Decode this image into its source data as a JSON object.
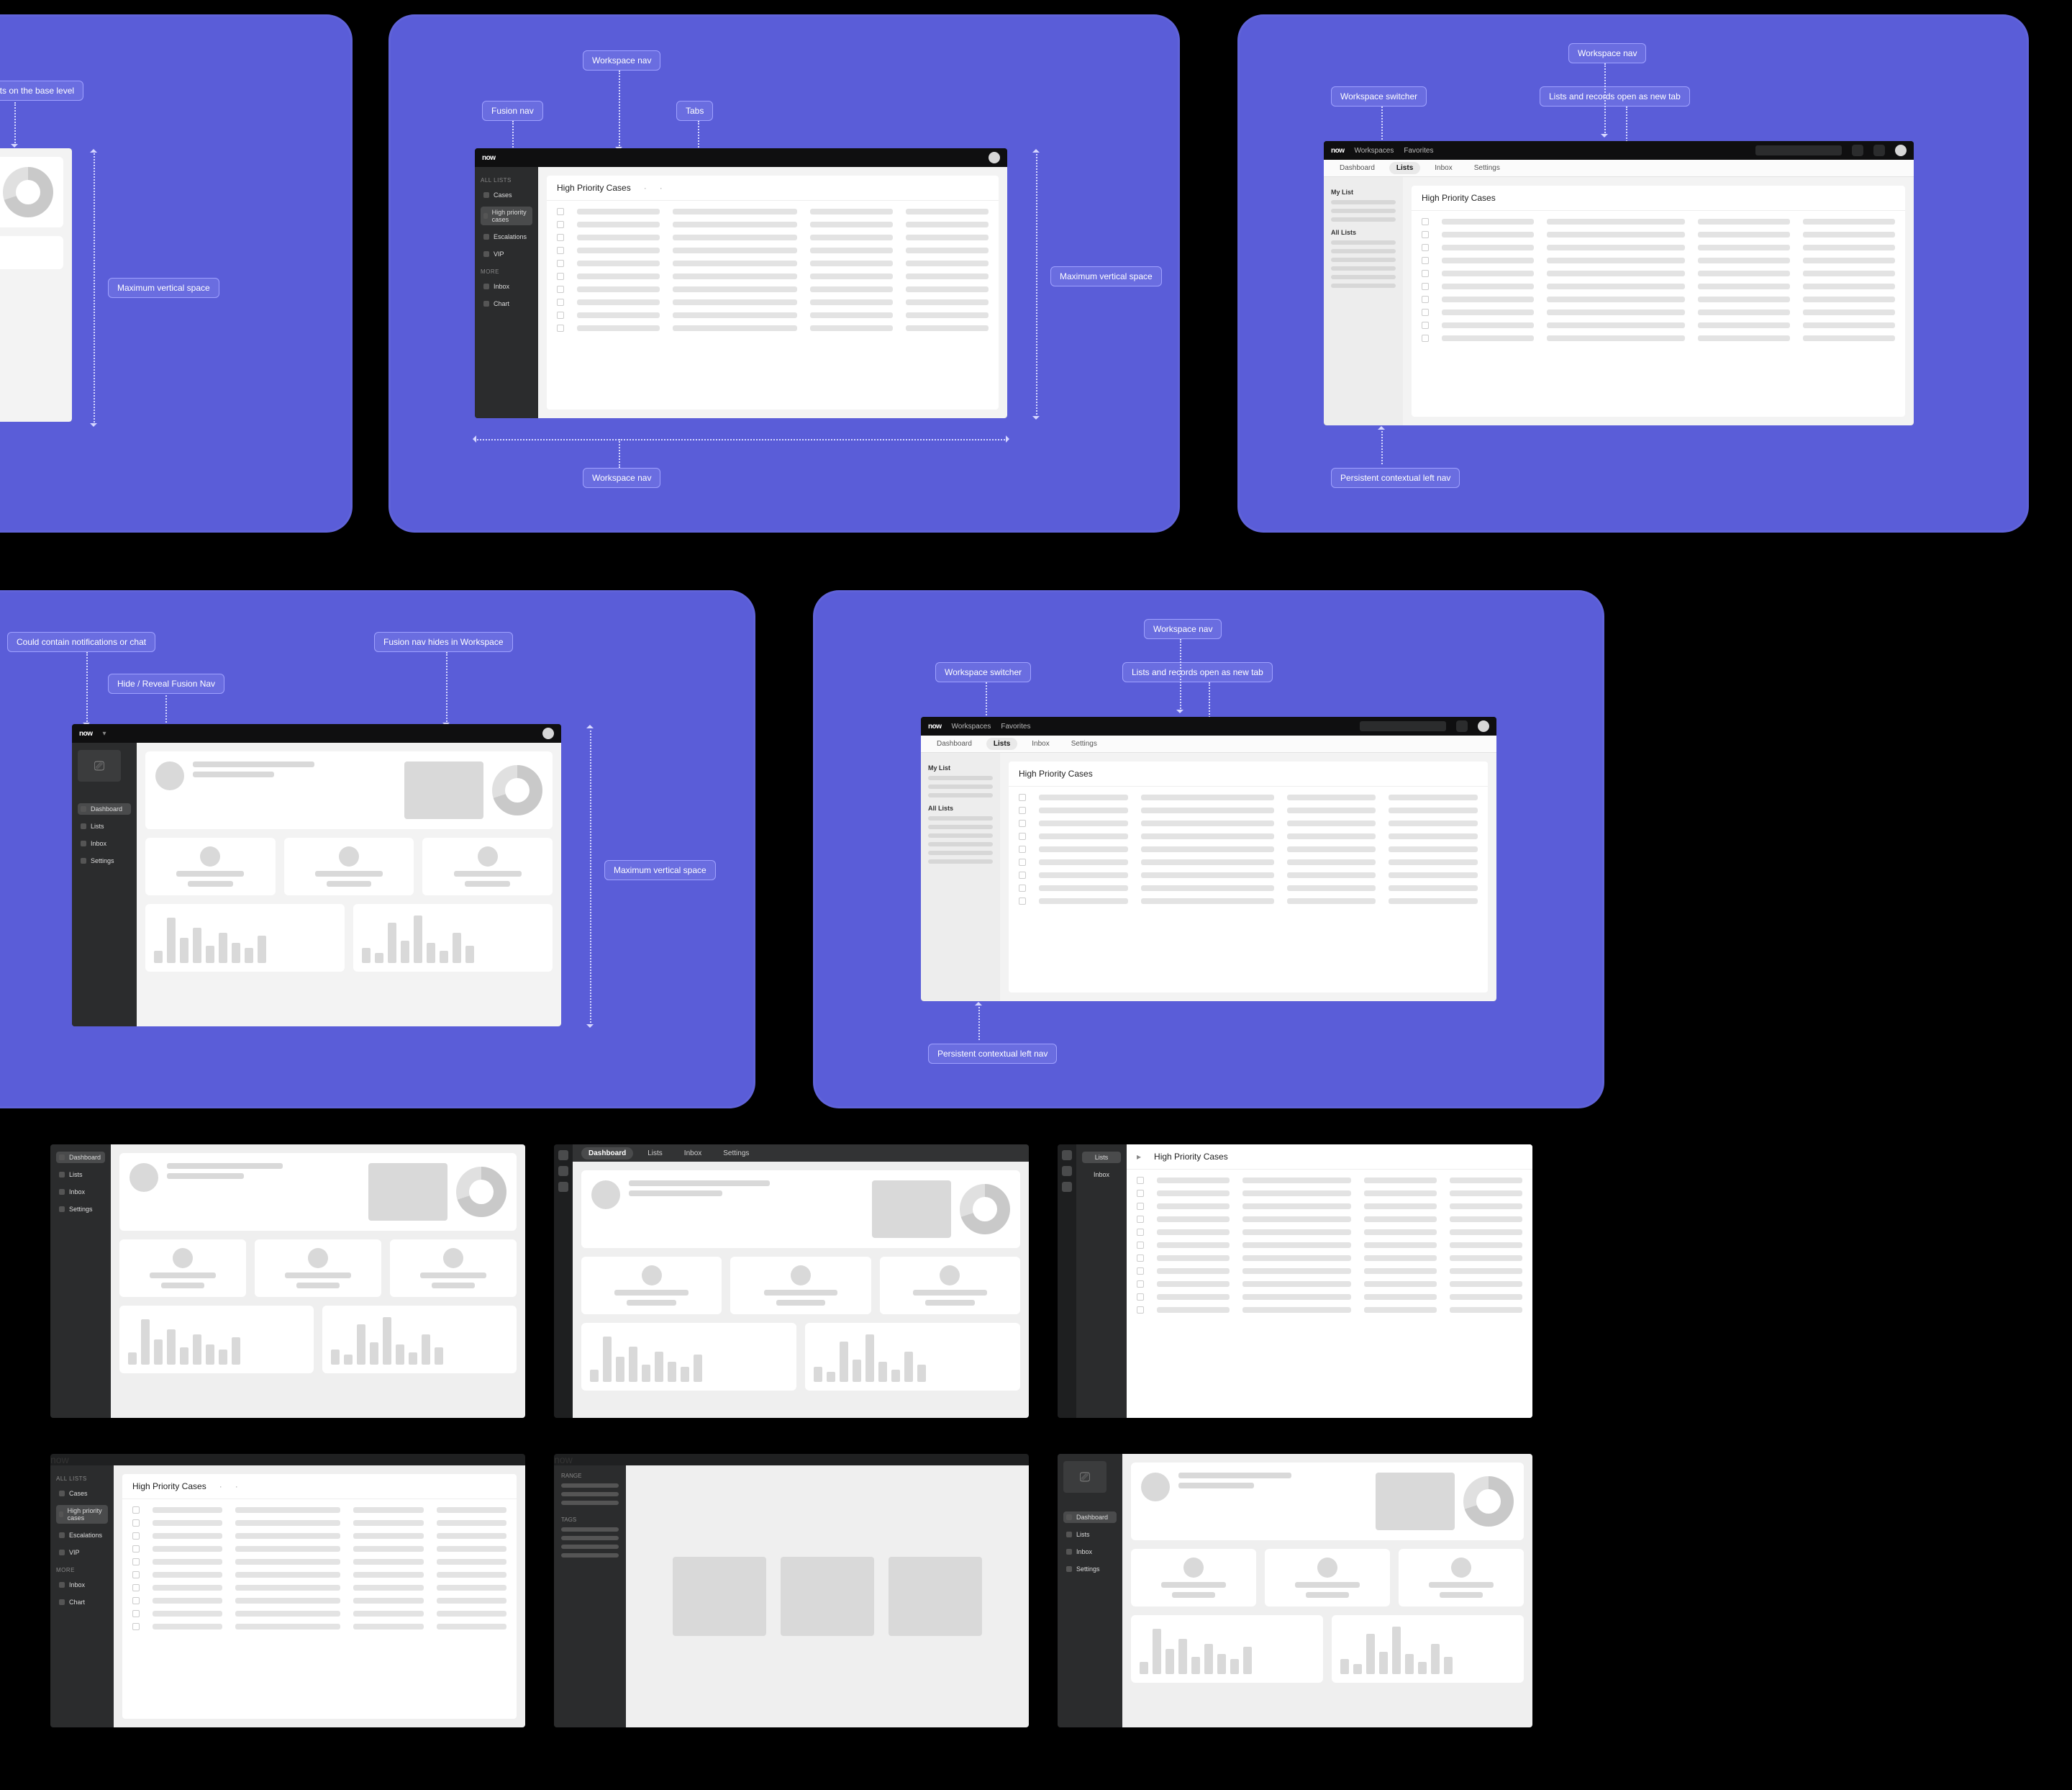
{
  "brand": "now",
  "topbar": {
    "workspaces": "Workspaces",
    "favorites": "Favorites"
  },
  "wsnav": {
    "dashboard": "Dashboard",
    "lists": "Lists",
    "inbox": "Inbox",
    "settings": "Settings"
  },
  "rail": {
    "allListsHeader": "All Lists",
    "cases": "Cases",
    "highPriority": "High priority cases",
    "escalated": "Escalations",
    "vip": "VIP",
    "moreHeader": "More",
    "inbox": "Inbox",
    "chart": "Chart",
    "dashboard": "Dashboard",
    "lists": "Lists",
    "settings": "Settings"
  },
  "ctxnav": {
    "myListHeader": "My List",
    "allListsHeader": "All Lists"
  },
  "list": {
    "title": "High Priority Cases"
  },
  "range": {
    "header": "Range",
    "tagsHeader": "Tags"
  },
  "tags": {
    "card1": {
      "baseLevel": "…xists on the base level",
      "maxV": "Maximum vertical space"
    },
    "card2": {
      "wsnav": "Workspace nav",
      "fusion": "Fusion nav",
      "tabs": "Tabs",
      "maxV": "Maximum vertical space",
      "wsnav2": "Workspace nav"
    },
    "card3": {
      "wsnav": "Workspace nav",
      "switcher": "Workspace switcher",
      "newtab": "Lists and records open as new tab",
      "leftnav": "Persistent contextual left nav"
    },
    "card4": {
      "notif": "Could contain notifications or chat",
      "hide": "Hide / Reveal Fusion Nav",
      "fusionHides": "Fusion nav hides in Workspace",
      "maxV": "Maximum vertical space"
    },
    "card5": {
      "wsnav": "Workspace nav",
      "switcher": "Workspace switcher",
      "newtab": "Lists and records open as new tab",
      "leftnav": "Persistent contextual left nav"
    }
  },
  "chart_data": {
    "type": "bar",
    "note": "Wireframe placeholder bar charts — heights are relative fractions, no numeric axes shown.",
    "bars_left": [
      0.25,
      0.9,
      0.5,
      0.7,
      0.35,
      0.6,
      0.4,
      0.3,
      0.55
    ],
    "bars_right": [
      0.3,
      0.2,
      0.8,
      0.45,
      0.95,
      0.4,
      0.25,
      0.6,
      0.35
    ],
    "donut_slices_pct": [
      70,
      30
    ]
  }
}
